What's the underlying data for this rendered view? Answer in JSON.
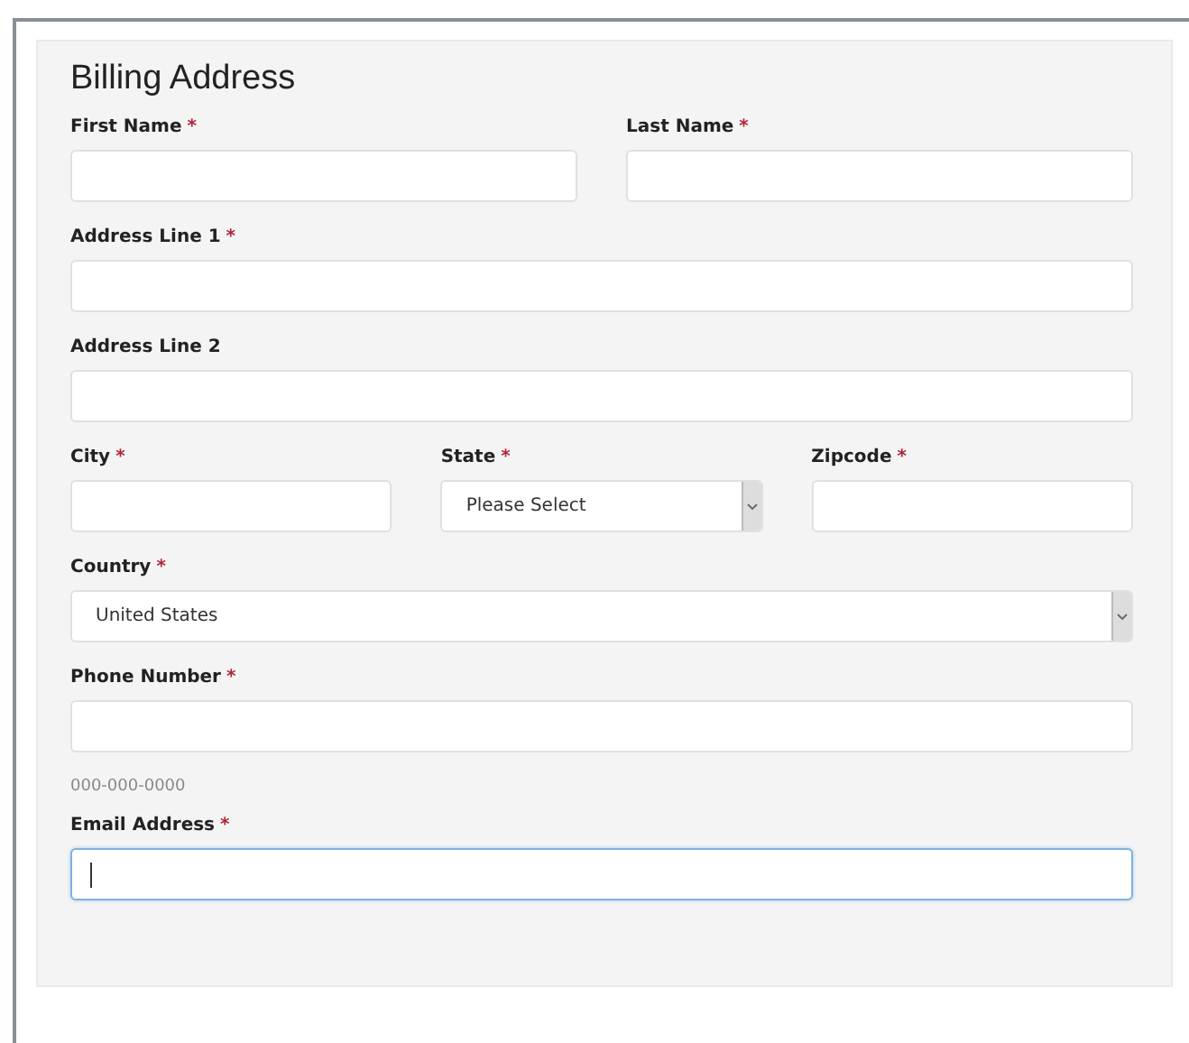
{
  "title": "Billing Address",
  "rows": [
    [
      {
        "kind": "text",
        "label": "First Name",
        "required_mark": "*",
        "focused": false
      },
      {
        "kind": "text",
        "label": "Last Name",
        "required_mark": "*",
        "focused": false
      }
    ],
    [
      {
        "kind": "text",
        "label": "Address Line 1",
        "required_mark": "*",
        "focused": false
      }
    ],
    [
      {
        "kind": "text",
        "label": "Address Line 2",
        "focused": false
      }
    ],
    [
      {
        "kind": "text",
        "label": "City",
        "required_mark": "*",
        "focused": false
      },
      {
        "kind": "select",
        "label": "State",
        "required_mark": "*",
        "value": "Please Select",
        "focused": false
      },
      {
        "kind": "text",
        "label": "Zipcode",
        "required_mark": "*",
        "focused": false
      }
    ],
    [
      {
        "kind": "select",
        "label": "Country",
        "required_mark": "*",
        "value": "United States",
        "focused": false
      }
    ],
    [
      {
        "kind": "text",
        "label": "Phone Number",
        "required_mark": "*",
        "hint": "000-000-0000",
        "focused": false
      }
    ],
    [
      {
        "kind": "text",
        "label": "Email Address",
        "required_mark": "*",
        "focused": true
      }
    ]
  ]
}
